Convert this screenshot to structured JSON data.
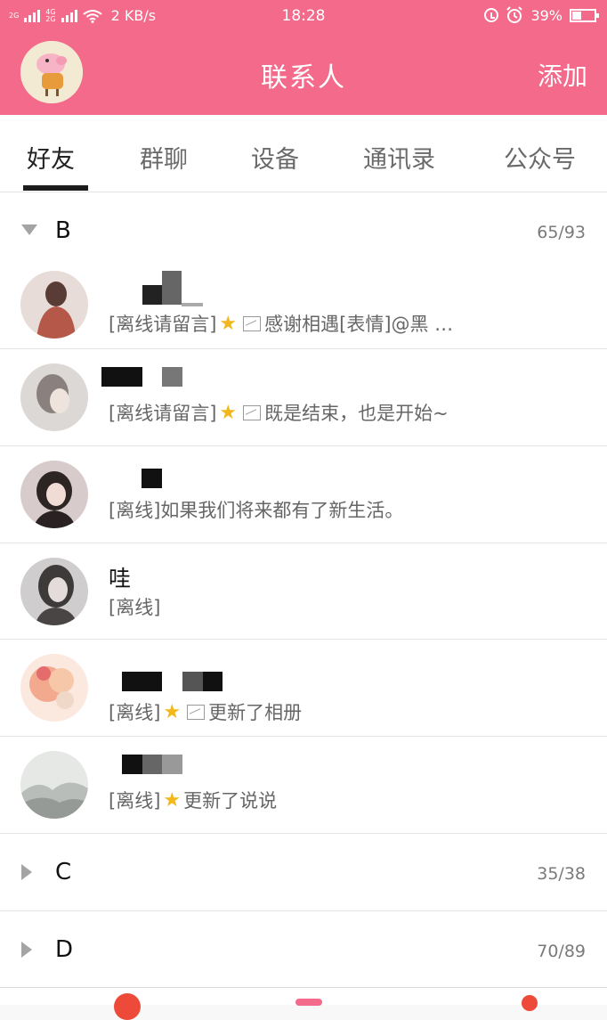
{
  "status_bar": {
    "network_1": "2G",
    "network_2a": "4G",
    "network_2b": "2G",
    "speed": "2 KB/s",
    "time": "18:28",
    "battery_text": "39%",
    "battery_level": 0.39
  },
  "header": {
    "title": "联系人",
    "add_label": "添加"
  },
  "tabs": [
    {
      "label": "好友",
      "active": true
    },
    {
      "label": "群聊",
      "active": false
    },
    {
      "label": "设备",
      "active": false
    },
    {
      "label": "通讯录",
      "active": false
    },
    {
      "label": "公众号",
      "active": false
    }
  ],
  "groups": [
    {
      "name": "B",
      "count": "65/93",
      "expanded": true
    },
    {
      "name": "C",
      "count": "35/38",
      "expanded": false
    },
    {
      "name": "D",
      "count": "70/89",
      "expanded": false
    }
  ],
  "contacts": [
    {
      "nickname": "",
      "status": "[离线请留言]",
      "star": true,
      "image": true,
      "message": "感谢相遇[表情]@黑 …"
    },
    {
      "nickname": "",
      "status": "[离线请留言]",
      "star": true,
      "image": true,
      "message": "既是结束，也是开始~"
    },
    {
      "nickname": "",
      "status": "[离线]",
      "star": false,
      "image": false,
      "message": "如果我们将来都有了新生活。"
    },
    {
      "nickname": "哇",
      "status": "[离线]",
      "star": false,
      "image": false,
      "message": ""
    },
    {
      "nickname": "",
      "status": "[离线]",
      "star": true,
      "image": true,
      "message": "更新了相册"
    },
    {
      "nickname": "",
      "status": "[离线]",
      "star": true,
      "image": false,
      "message": "更新了说说"
    }
  ],
  "colors": {
    "accent": "#f46a8b",
    "star": "#f2b71b",
    "text_primary": "#111111",
    "text_secondary": "#666666"
  },
  "icons": {
    "star": "★"
  }
}
